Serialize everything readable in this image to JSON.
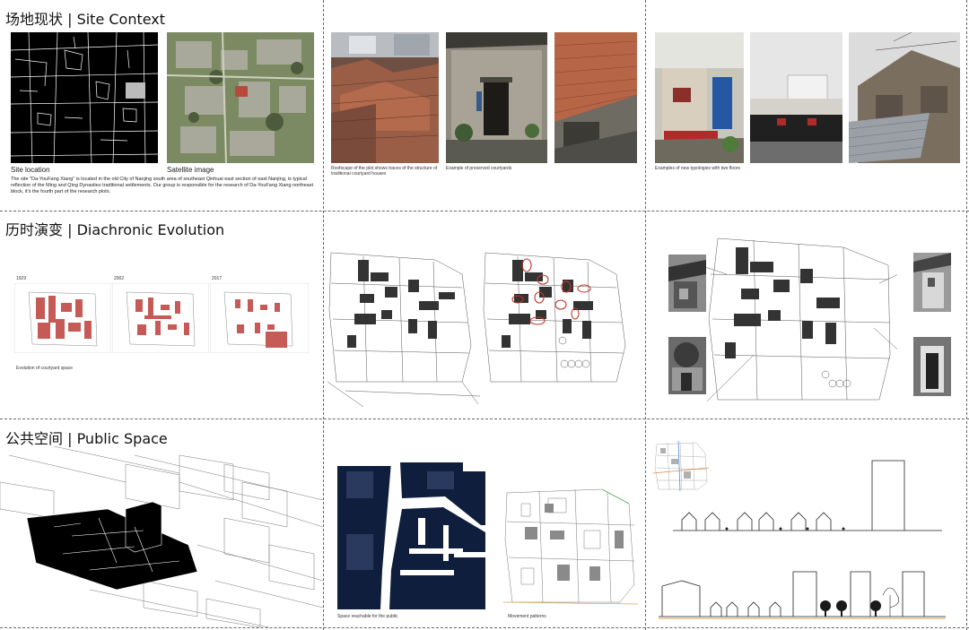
{
  "sections": {
    "site_context": "场地现状 | Site Context",
    "diachronic": "历时演变 | Diachronic Evolution",
    "public_space": "公共空间 | Public Space"
  },
  "site_context": {
    "site_location": "Site location",
    "satellite_image": "Satellite image",
    "description": "The site \"Da-YouFang Xiang\" is located in the old City of Nanjing south area of southeast Qinhuai east section of east Nanjing, is typical reflection of the Ming and Qing Dynasties traditional settlements. Our group is responsible for the research of Da-YouFang Xiang northeast block, it's the fourth part of the research plots.",
    "roofscape_caption": "Roofscape of the plot shows traces of the structure of traditional courtyard houses",
    "courtyards_caption": "Example of preserved courtyards",
    "typologies_caption": "Examples of new typologies with two floors"
  },
  "diachronic": {
    "years": [
      "1929",
      "2002",
      "2017"
    ],
    "evolution_caption": "Evolution of courtyard space"
  },
  "public_space": {
    "reachable_caption": "Space reachable for the public",
    "movement_caption": "Movement patterns"
  },
  "colors": {
    "accent_red": "#c0504d",
    "dark_blue": "#0f1e3d",
    "divider": "#666666"
  }
}
